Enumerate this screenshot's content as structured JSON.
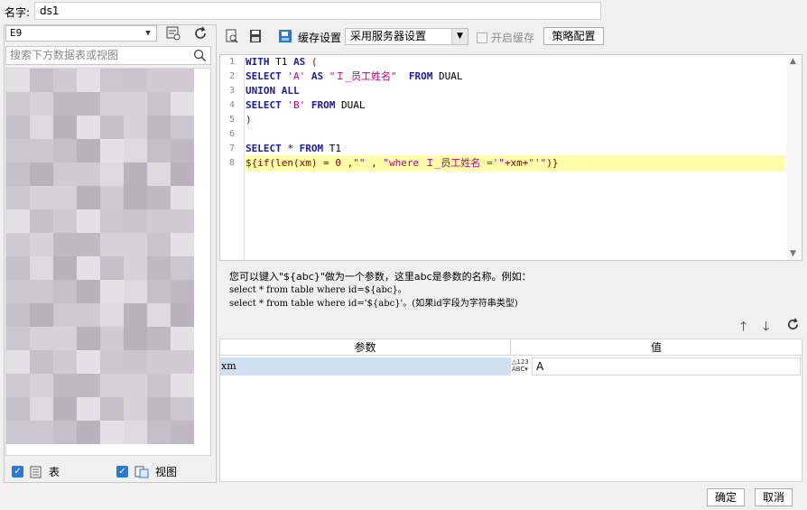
{
  "name_label": "名字:",
  "name_value": "ds1",
  "left": {
    "db_value": "E9",
    "search_placeholder": "搜索下方数据表或视图",
    "check_table": "表",
    "check_view": "视图"
  },
  "toolbar": {
    "cache_label": "缓存设置",
    "cache_select": "采用服务器设置",
    "enable_cache": "开启缓存",
    "strategy": "策略配置"
  },
  "sql_lines": [
    {
      "n": "1"
    },
    {
      "n": "2"
    },
    {
      "n": "3"
    },
    {
      "n": "4"
    },
    {
      "n": "5"
    },
    {
      "n": "6"
    },
    {
      "n": "7"
    },
    {
      "n": "8"
    }
  ],
  "sql_text": {
    "l1a": "WITH",
    "l1b": " T1 ",
    "l1c": "AS",
    "l1d": " (",
    "l2a": "SELECT",
    "l2b": "'A'",
    "l2c": "AS",
    "l2d": "\"Ｉ_员工姓名\"",
    "l2e": "FROM",
    "l2f": " DUAL",
    "l3a": "UNION ALL",
    "l4a": "SELECT",
    "l4b": "'B'",
    "l4c": "FROM",
    "l4d": " DUAL",
    "l5a": ")",
    "l7a": "SELECT",
    "l7b": " * ",
    "l7c": "FROM",
    "l7d": " T1",
    "l8a": "${if(len(xm) = 0 ,",
    "l8b": "\"\"",
    "l8c": " , ",
    "l8d": "\"where Ｉ_员工姓名 ='\"",
    "l8e": "+xm+",
    "l8f": "\"'\"",
    "l8g": ")}"
  },
  "help": {
    "line1": "您可以键入\"${abc}\"做为一个参数，这里abc是参数的名称。例如：",
    "line2": "select * from table where id=${abc}。",
    "line3": "select * from table where id='${abc}'。(如果id字段为字符串类型)"
  },
  "params": {
    "col_param": "参数",
    "col_value": "值",
    "rows": [
      {
        "name": "xm",
        "value": "A"
      }
    ]
  },
  "footer": {
    "ok": "确定",
    "cancel": "取消"
  },
  "colors": {
    "accent": "#2b79d2",
    "highlight": "#ffffa9",
    "selected_row": "#cfe0f0"
  }
}
